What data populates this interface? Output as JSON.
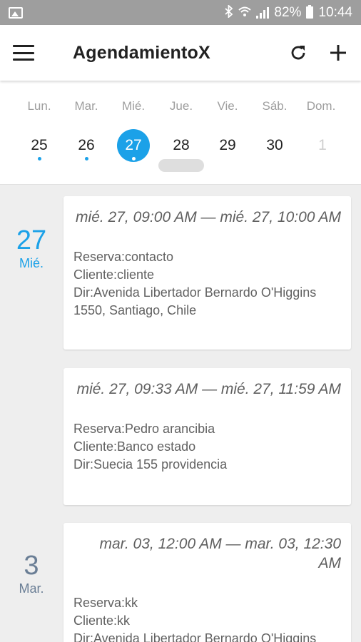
{
  "status_bar": {
    "battery": "82%",
    "time": "10:44"
  },
  "app_bar": {
    "title": "AgendamientoX"
  },
  "week": {
    "day_names": [
      "Lun.",
      "Mar.",
      "Mié.",
      "Jue.",
      "Vie.",
      "Sáb.",
      "Dom."
    ],
    "days": [
      {
        "num": "25",
        "has_event": true,
        "selected": false,
        "muted": false
      },
      {
        "num": "26",
        "has_event": true,
        "selected": false,
        "muted": false
      },
      {
        "num": "27",
        "has_event": true,
        "selected": true,
        "muted": false
      },
      {
        "num": "28",
        "has_event": false,
        "selected": false,
        "muted": false
      },
      {
        "num": "29",
        "has_event": false,
        "selected": false,
        "muted": false
      },
      {
        "num": "30",
        "has_event": false,
        "selected": false,
        "muted": false
      },
      {
        "num": "1",
        "has_event": false,
        "selected": false,
        "muted": true
      }
    ]
  },
  "agenda": {
    "groups": [
      {
        "date_num": "27",
        "date_dow": "Mié."
      },
      {
        "date_num": "3",
        "date_dow": "Mar."
      }
    ],
    "events": [
      {
        "time": "mié. 27, 09:00 AM — mié. 27, 10:00 AM",
        "reserva": "Reserva:contacto",
        "cliente": "Cliente:cliente",
        "dir": "Dir:Avenida Libertador Bernardo O'Higgins 1550, Santiago, Chile"
      },
      {
        "time": "mié. 27, 09:33 AM — mié. 27, 11:59 AM",
        "reserva": "Reserva:Pedro arancibia",
        "cliente": "Cliente:Banco estado",
        "dir": "Dir:Suecia 155 providencia"
      },
      {
        "time": "mar. 03, 12:00 AM — mar. 03, 12:30 AM",
        "reserva": "Reserva:kk",
        "cliente": "Cliente:kk",
        "dir": "Dir:Avenida Libertador Bernardo O'Higgins"
      }
    ]
  },
  "colors": {
    "accent": "#1ba1e8",
    "status_bar": "#9e9e9e",
    "muted_date": "#6a7e95"
  }
}
